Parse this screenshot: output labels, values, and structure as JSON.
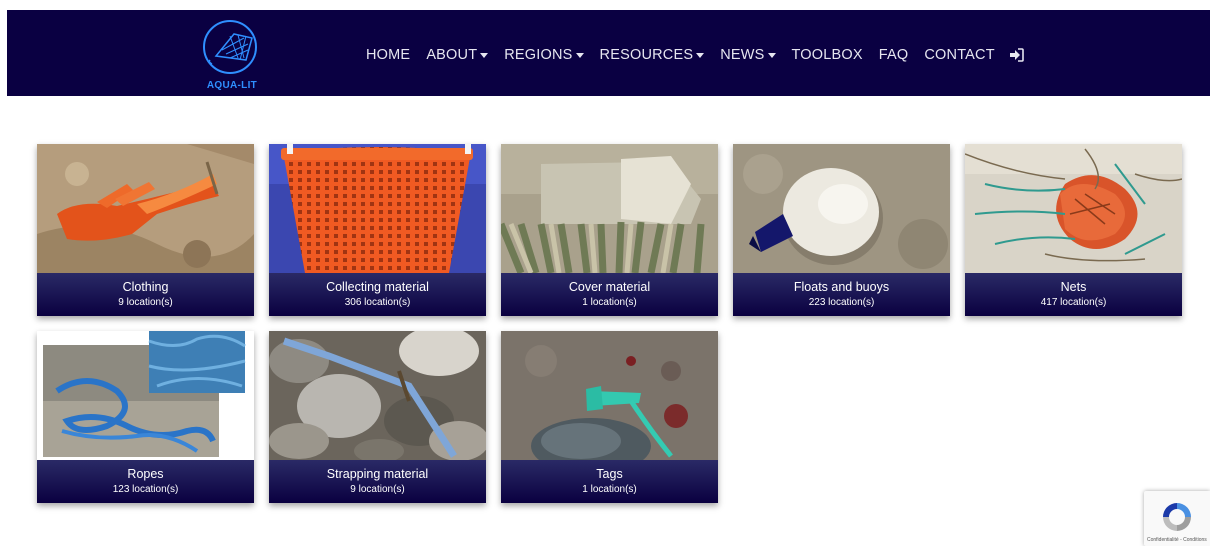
{
  "brand": {
    "logo_text": "AQUA-LIT"
  },
  "nav": {
    "items": [
      {
        "label": "HOME",
        "dropdown": false
      },
      {
        "label": "ABOUT",
        "dropdown": true
      },
      {
        "label": "REGIONS",
        "dropdown": true
      },
      {
        "label": "RESOURCES",
        "dropdown": true
      },
      {
        "label": "NEWS",
        "dropdown": true
      },
      {
        "label": "TOOLBOX",
        "dropdown": false
      },
      {
        "label": "FAQ",
        "dropdown": false
      },
      {
        "label": "CONTACT",
        "dropdown": false
      }
    ],
    "login_icon": "sign-in-icon"
  },
  "categories": [
    {
      "title": "Clothing",
      "count": "9 location(s)"
    },
    {
      "title": "Collecting material",
      "count": "306 location(s)"
    },
    {
      "title": "Cover material",
      "count": "1 location(s)"
    },
    {
      "title": "Floats and buoys",
      "count": "223 location(s)"
    },
    {
      "title": "Nets",
      "count": "417 location(s)"
    },
    {
      "title": "Ropes",
      "count": "123 location(s)"
    },
    {
      "title": "Strapping material",
      "count": "9 location(s)"
    },
    {
      "title": "Tags",
      "count": "1 location(s)"
    }
  ],
  "recaptcha": {
    "footer": "Confidentialité - Conditions",
    "icon": "recaptcha-icon"
  },
  "colors": {
    "navbar": "#0a0042",
    "caption_top": "#2a2a66",
    "caption_bottom": "#0a0040",
    "logo": "#2f8fff"
  }
}
